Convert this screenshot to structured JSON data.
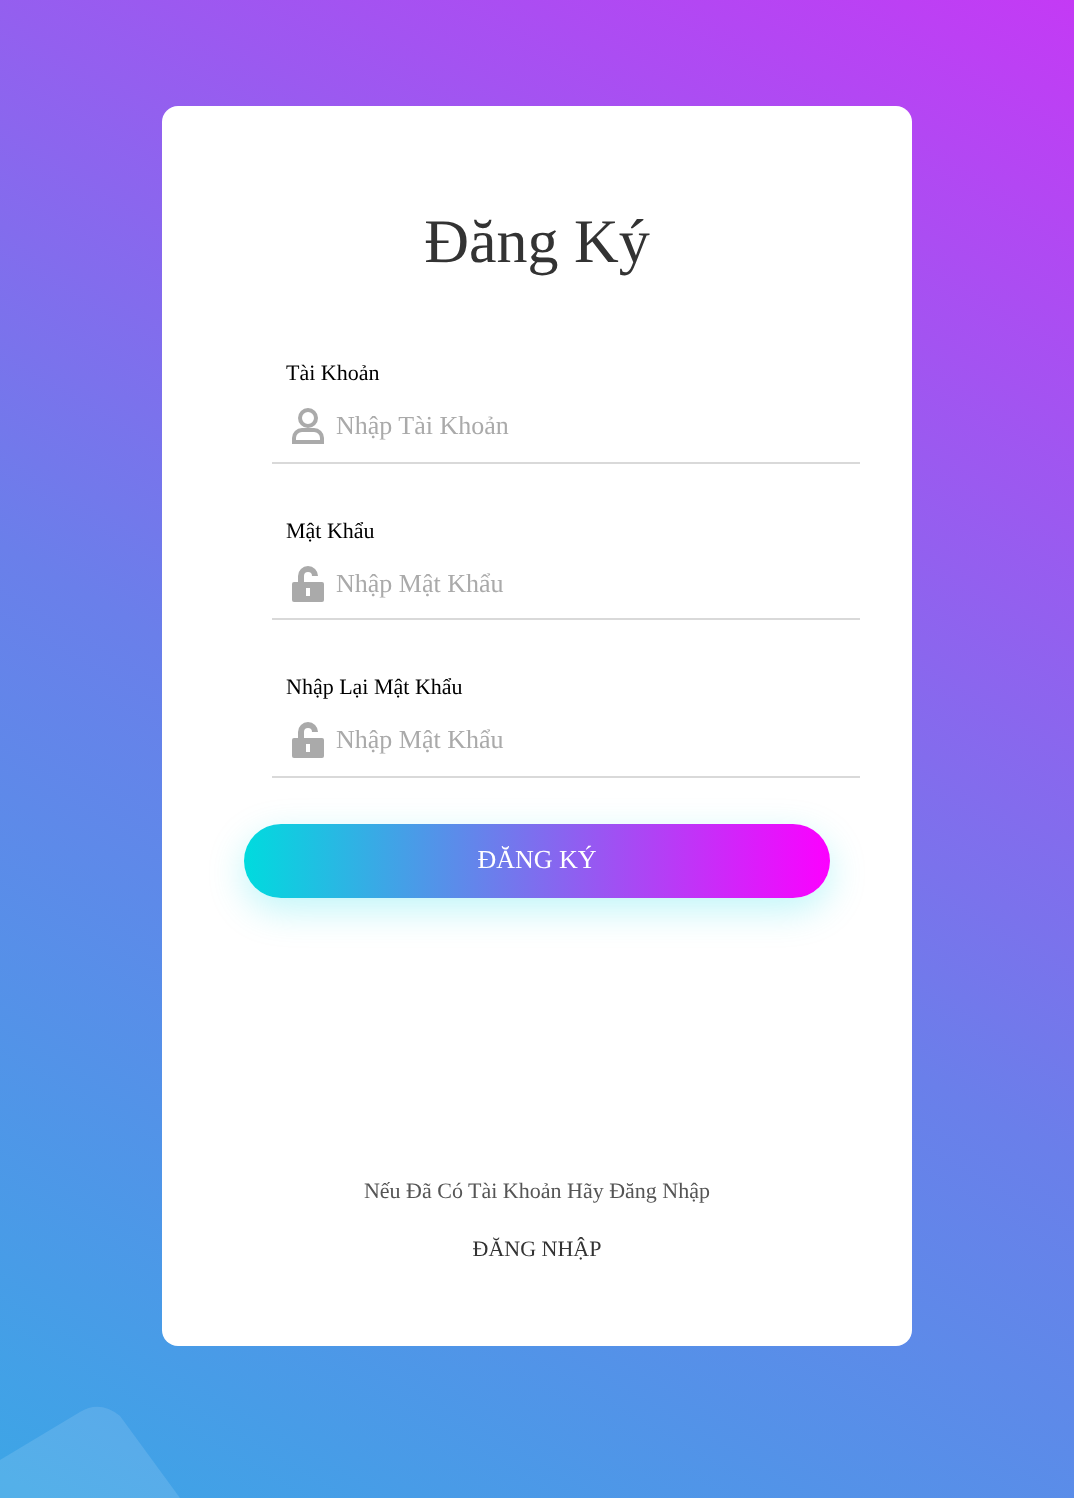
{
  "title": "Đăng Ký",
  "fields": [
    {
      "label": "Tài Khoản",
      "placeholder": "Nhập Tài Khoản",
      "kind": "user"
    },
    {
      "label": "Mật Khẩu",
      "placeholder": "Nhập Mật Khẩu",
      "kind": "lock"
    },
    {
      "label": "Nhập Lại Mật Khẩu",
      "placeholder": "Nhập Mật Khẩu",
      "kind": "lock"
    }
  ],
  "submit": "ĐĂNG KÝ",
  "footer": {
    "prompt": "Nếu Đã Có Tài Khoản Hãy Đăng Nhập",
    "link": "ĐĂNG NHẬP"
  }
}
